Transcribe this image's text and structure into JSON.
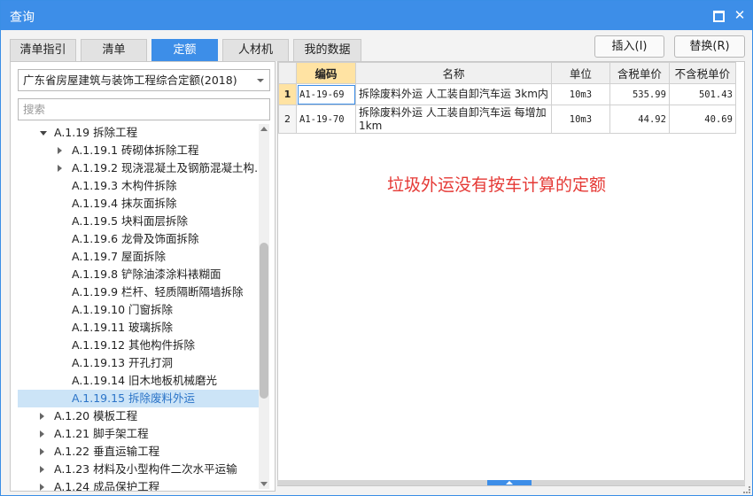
{
  "window": {
    "title": "查询"
  },
  "tabs": [
    "清单指引",
    "清单",
    "定额",
    "人材机",
    "我的数据"
  ],
  "active_tab": "定额",
  "actions": {
    "insert": "插入(I)",
    "replace": "替换(R)"
  },
  "left": {
    "dropdown_value": "广东省房屋建筑与装饰工程综合定额(2018)",
    "search_placeholder": "搜索",
    "tree": [
      {
        "label": "A.1.19 拆除工程",
        "level": 1,
        "toggle": "down"
      },
      {
        "label": "A.1.19.1 砖砌体拆除工程",
        "level": 2,
        "toggle": "right"
      },
      {
        "label": "A.1.19.2 现浇混凝土及钢筋混凝土构…",
        "level": 2,
        "toggle": "right"
      },
      {
        "label": "A.1.19.3 木构件拆除",
        "level": 2,
        "toggle": "none"
      },
      {
        "label": "A.1.19.4 抹灰面拆除",
        "level": 2,
        "toggle": "none"
      },
      {
        "label": "A.1.19.5 块料面层拆除",
        "level": 2,
        "toggle": "none"
      },
      {
        "label": "A.1.19.6 龙骨及饰面拆除",
        "level": 2,
        "toggle": "none"
      },
      {
        "label": "A.1.19.7 屋面拆除",
        "level": 2,
        "toggle": "none"
      },
      {
        "label": "A.1.19.8 铲除油漆涂料裱糊面",
        "level": 2,
        "toggle": "none"
      },
      {
        "label": "A.1.19.9 栏杆、轻质隔断隔墙拆除",
        "level": 2,
        "toggle": "none"
      },
      {
        "label": "A.1.19.10 门窗拆除",
        "level": 2,
        "toggle": "none"
      },
      {
        "label": "A.1.19.11 玻璃拆除",
        "level": 2,
        "toggle": "none"
      },
      {
        "label": "A.1.19.12 其他构件拆除",
        "level": 2,
        "toggle": "none"
      },
      {
        "label": "A.1.19.13 开孔打洞",
        "level": 2,
        "toggle": "none"
      },
      {
        "label": "A.1.19.14 旧木地板机械磨光",
        "level": 2,
        "toggle": "none"
      },
      {
        "label": "A.1.19.15 拆除废料外运",
        "level": 2,
        "toggle": "none",
        "selected": true
      },
      {
        "label": "A.1.20 模板工程",
        "level": 1,
        "toggle": "right"
      },
      {
        "label": "A.1.21 脚手架工程",
        "level": 1,
        "toggle": "right"
      },
      {
        "label": "A.1.22 垂直运输工程",
        "level": 1,
        "toggle": "right"
      },
      {
        "label": "A.1.23 材料及小型构件二次水平运输",
        "level": 1,
        "toggle": "right"
      },
      {
        "label": "A.1.24 成品保护工程",
        "level": 1,
        "toggle": "right"
      }
    ]
  },
  "table": {
    "headers": {
      "code": "编码",
      "name": "名称",
      "unit": "单位",
      "tax_price": "含税单价",
      "notax_price": "不含税单价"
    },
    "rows": [
      {
        "num": "1",
        "code": "A1-19-69",
        "name": "拆除废料外运 人工装自卸汽车运 3km内",
        "unit": "10m3",
        "tax_price": "535.99",
        "notax_price": "501.43"
      },
      {
        "num": "2",
        "code": "A1-19-70",
        "name": "拆除废料外运 人工装自卸汽车运 每增加1km",
        "unit": "10m3",
        "tax_price": "44.92",
        "notax_price": "40.69"
      }
    ]
  },
  "annotation": "垃圾外运没有按车计算的定额"
}
